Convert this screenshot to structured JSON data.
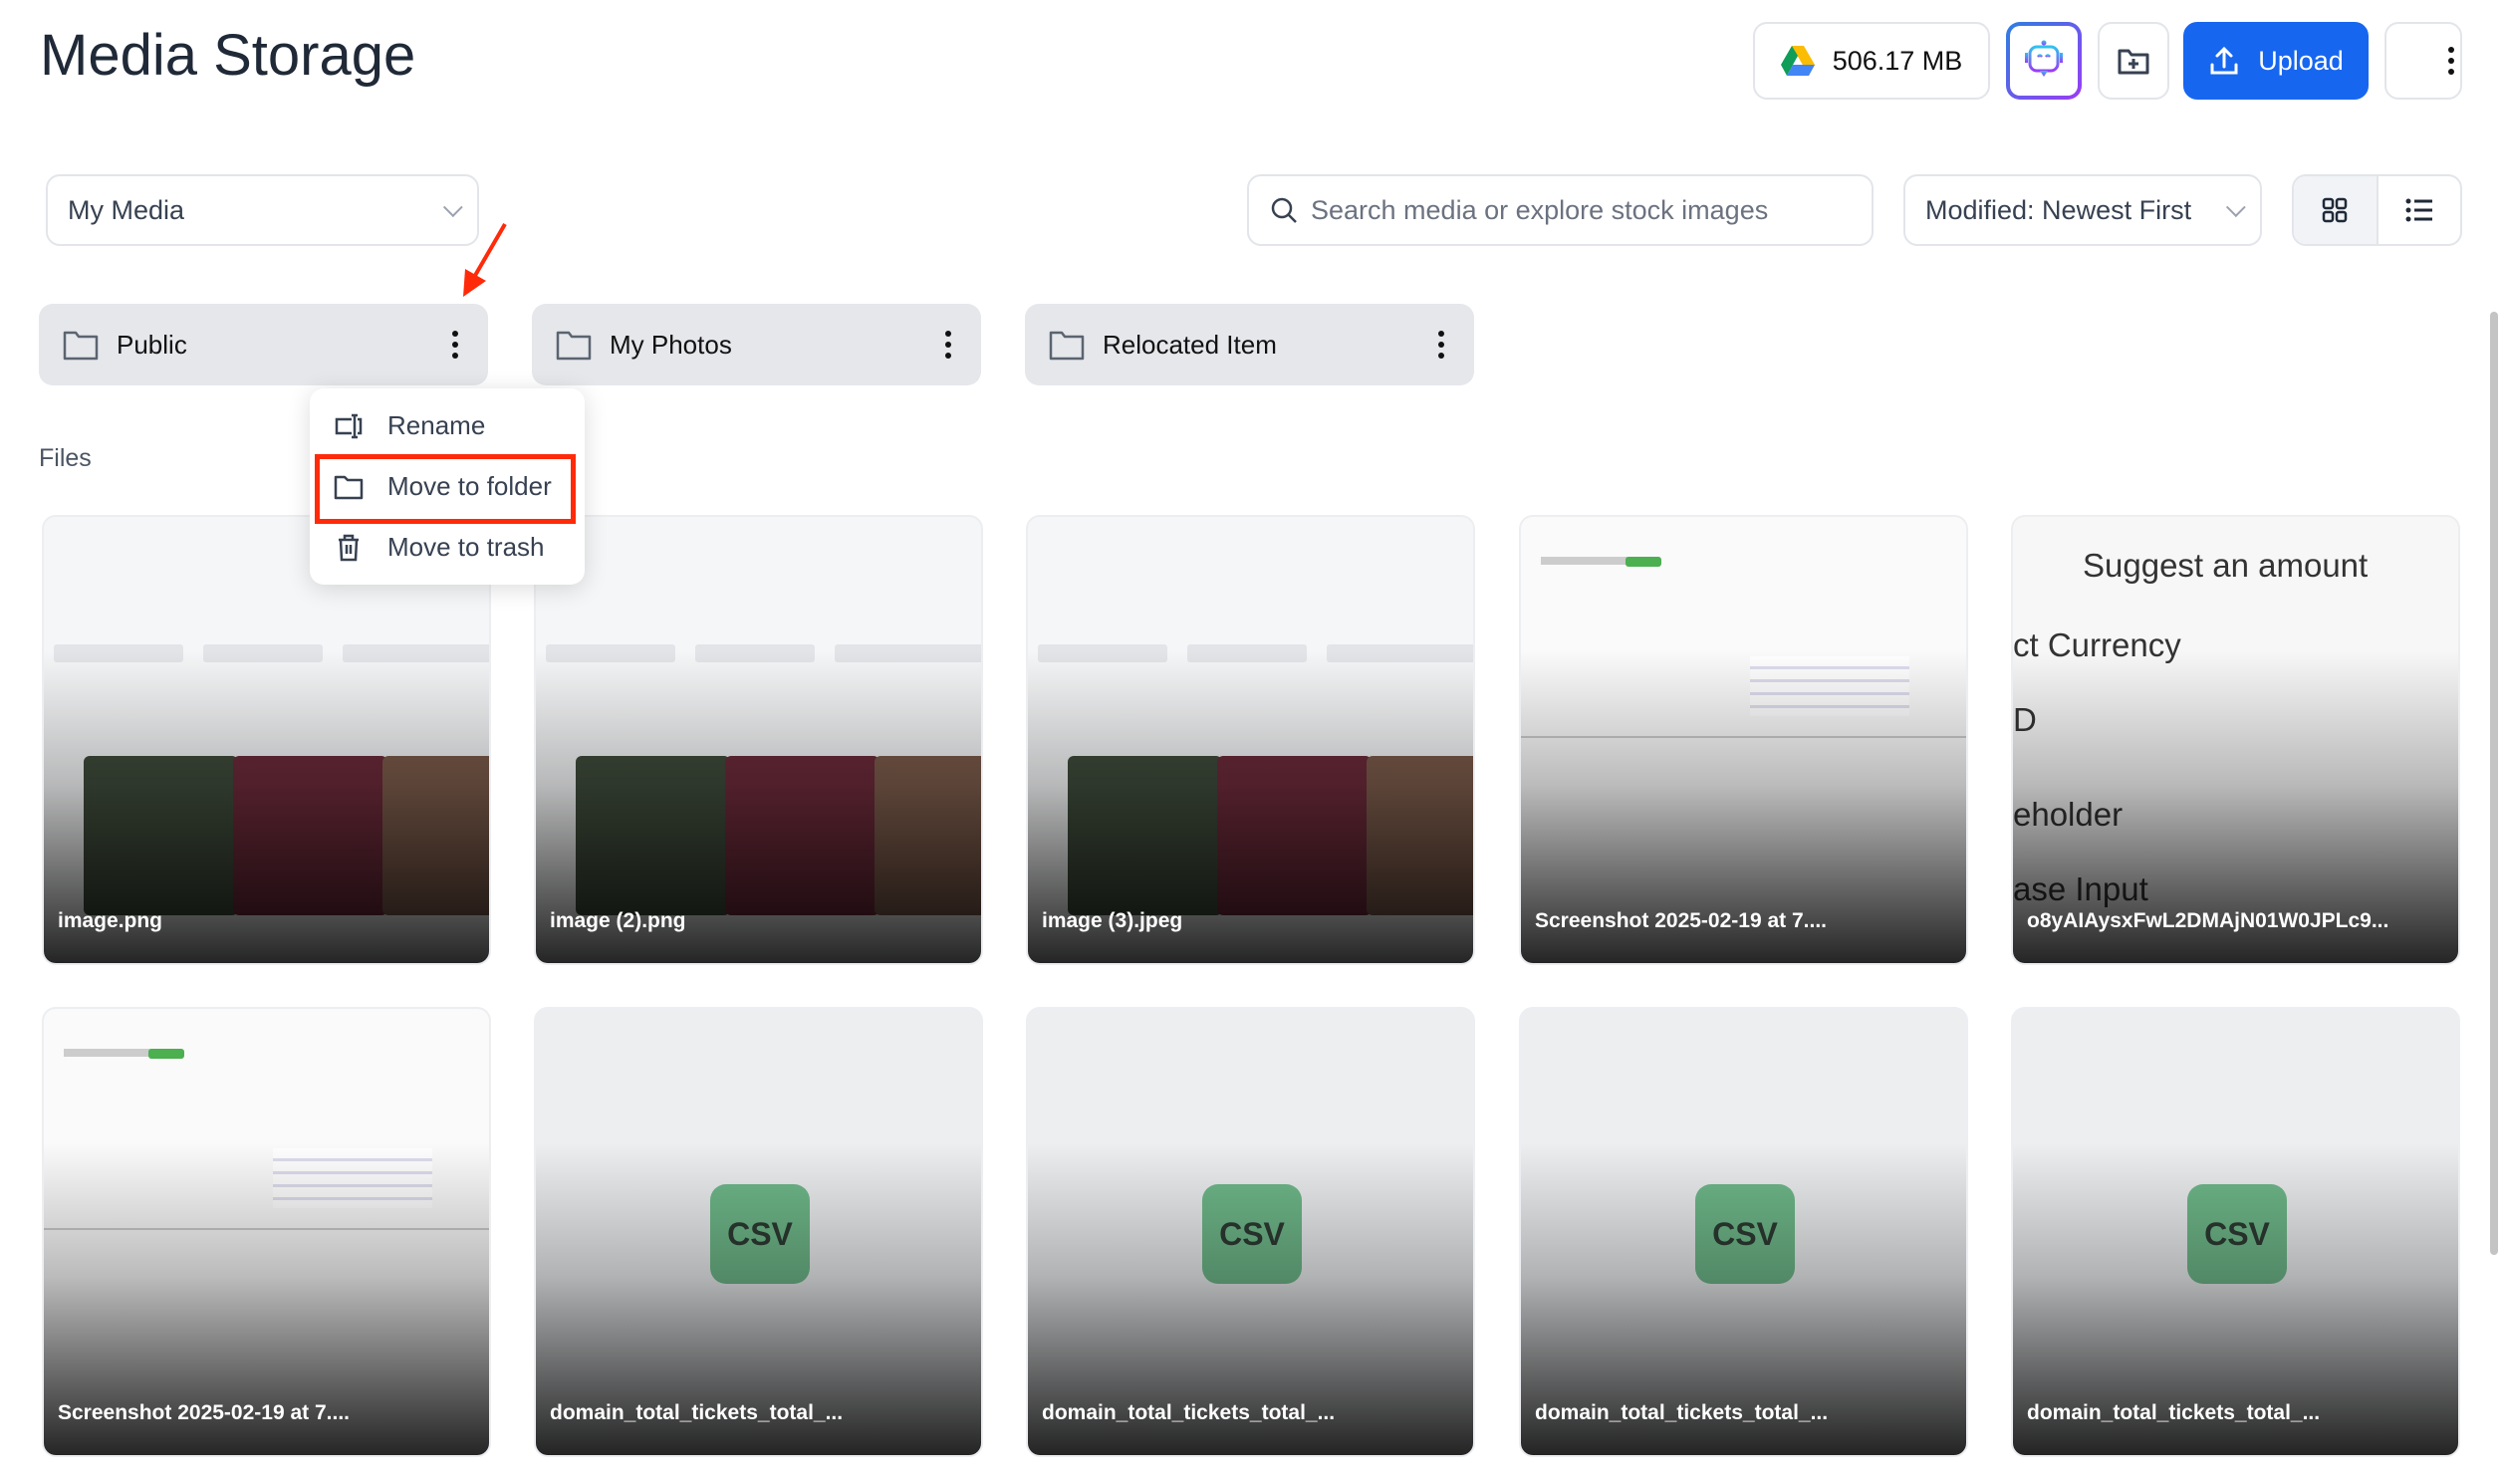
{
  "header": {
    "title": "Media Storage",
    "storage_label": "506.17 MB",
    "upload_label": "Upload"
  },
  "toolbar": {
    "source_select": "My Media",
    "search_placeholder": "Search media or explore stock images",
    "sort_select": "Modified: Newest First",
    "view_mode": "grid"
  },
  "folders": [
    {
      "name": "Public"
    },
    {
      "name": "My Photos"
    },
    {
      "name": "Relocated Item"
    }
  ],
  "context_menu": {
    "items": [
      {
        "label": "Rename",
        "icon": "rename-icon"
      },
      {
        "label": "Move to folder",
        "icon": "folder-icon",
        "highlighted": true
      },
      {
        "label": "Move to trash",
        "icon": "trash-icon"
      }
    ]
  },
  "files_label": "Files",
  "files": [
    {
      "name": "image.png",
      "kind": "image"
    },
    {
      "name": "image (2).png",
      "kind": "image"
    },
    {
      "name": "image (3).jpeg",
      "kind": "image"
    },
    {
      "name": "Screenshot 2025-02-19 at 7....",
      "kind": "screenshot"
    },
    {
      "name": "o8yAIAysxFwL2DMAjN01W0JPLc9...",
      "kind": "form",
      "preview_lines": [
        "Suggest an amount",
        "ct Currency",
        "D",
        "eholder",
        "ase Input"
      ]
    },
    {
      "name": "Screenshot 2025-02-19 at 7....",
      "kind": "screenshot"
    },
    {
      "name": "domain_total_tickets_total_...",
      "kind": "csv",
      "badge": "CSV"
    },
    {
      "name": "domain_total_tickets_total_...",
      "kind": "csv",
      "badge": "CSV"
    },
    {
      "name": "domain_total_tickets_total_...",
      "kind": "csv",
      "badge": "CSV"
    },
    {
      "name": "domain_total_tickets_total_...",
      "kind": "csv",
      "badge": "CSV"
    }
  ],
  "colors": {
    "accent": "#1766f0",
    "highlight": "#ff2a0a",
    "csv_badge": "#6fb98a"
  }
}
